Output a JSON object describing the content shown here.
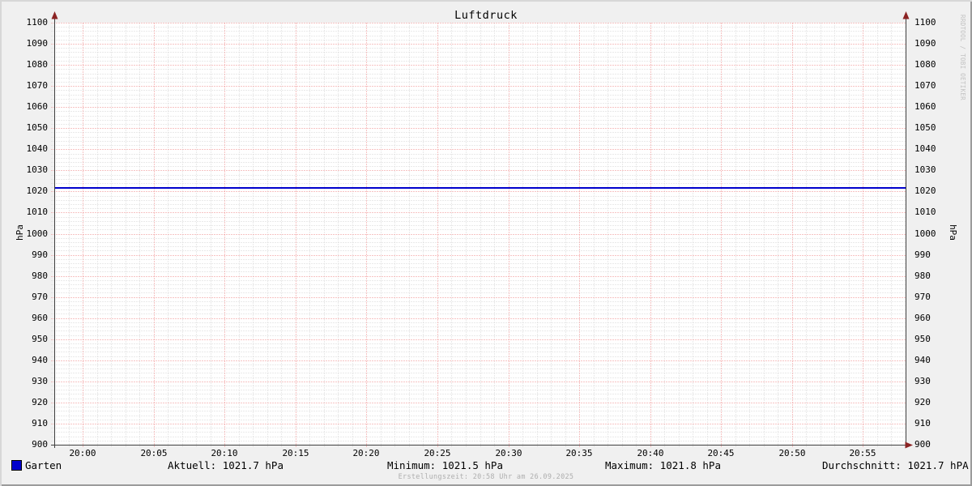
{
  "title": "Luftdruck",
  "watermark": "RRDTOOL / TOBI OETIKER",
  "footer": "Erstellungszeit: 20:58 Uhr am 26.09.2025",
  "legend": {
    "series_label": "Garten",
    "swatch_color": "#0000CC",
    "aktuell": "Aktuell: 1021.7 hPa",
    "minimum": "Minimum: 1021.5 hPa",
    "maximum": "Maximum: 1021.8 hPa",
    "durchschnitt": "Durchschnitt: 1021.7 hPA"
  },
  "chart_data": {
    "type": "line",
    "title": "Luftdruck",
    "ylabel_left": "hPa",
    "ylabel_right": "hPa",
    "ylim": [
      900,
      1100
    ],
    "y_major_step": 10,
    "y_minor_step": 2,
    "y_tick_labels": [
      "900",
      "910",
      "920",
      "930",
      "940",
      "950",
      "960",
      "970",
      "980",
      "990",
      "1000",
      "1010",
      "1020",
      "1030",
      "1040",
      "1050",
      "1060",
      "1070",
      "1080",
      "1090",
      "1100"
    ],
    "x_start": "19:58",
    "x_end": "20:58",
    "x_major_ticks": [
      "20:00",
      "20:05",
      "20:10",
      "20:15",
      "20:20",
      "20:25",
      "20:30",
      "20:35",
      "20:40",
      "20:45",
      "20:50",
      "20:55"
    ],
    "x_minor_step_minutes": 1,
    "grid_on": true,
    "legend_position": "bottom",
    "series": [
      {
        "name": "Garten",
        "type": "hline-constant",
        "value": 1021.7,
        "color": "#0000CC"
      }
    ],
    "stats": {
      "aktuell_hpa": 1021.7,
      "minimum_hpa": 1021.5,
      "maximum_hpa": 1021.8,
      "durchschnitt_hpa": 1021.7
    },
    "colors": {
      "background": "#f0f0f0",
      "canvas": "#ffffff",
      "major_grid": "#ef8a8a",
      "minor_grid": "#d6d6d6",
      "axis": "#3f3f3f",
      "arrow": "#8b2323",
      "shade_top_left": "#d7d7d7",
      "shade_bottom_right": "#9b9b9b",
      "watermark_text": "#c2c2c2",
      "footer_text": "#aeaeae"
    }
  }
}
